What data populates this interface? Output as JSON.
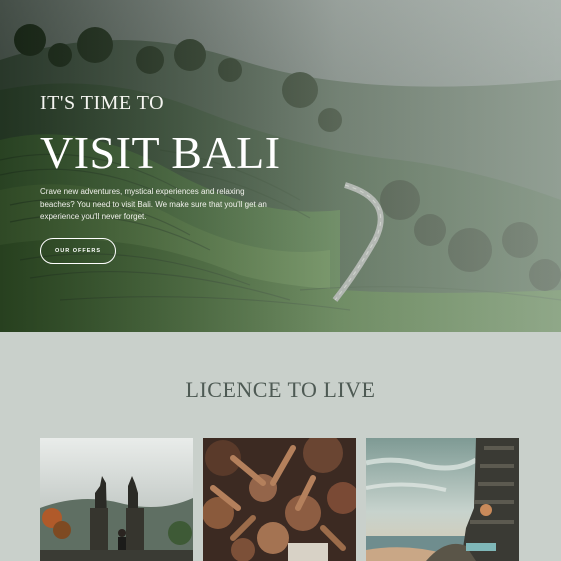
{
  "hero": {
    "eyebrow": "IT'S TIME TO",
    "title": "VISIT BALI",
    "text": "Crave new adventures, mystical experiences and relaxing beaches? You need to visit Bali. We make sure that you'll get an experience you'll never forget.",
    "cta_label": "OUR OFFERS"
  },
  "section": {
    "title": "LICENCE TO LIVE"
  },
  "cards": [
    {
      "image": "temple-gate-photo"
    },
    {
      "image": "dancing-crowd-photo"
    },
    {
      "image": "cliffside-villa-photo"
    }
  ],
  "colors": {
    "page_background": "#c9d0cb",
    "heading": "#4e5a54",
    "hero_text": "#ffffff"
  }
}
